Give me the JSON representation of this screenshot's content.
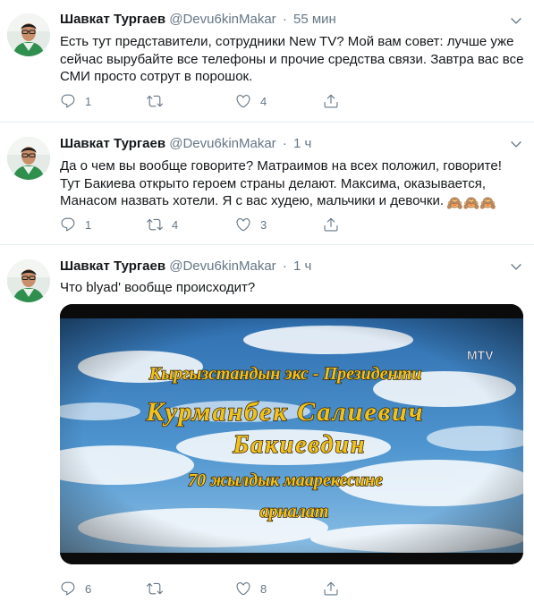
{
  "tweets": [
    {
      "name": "Шавкат Тургаев",
      "handle": "@Devu6kinMakar",
      "separator": "·",
      "time": "55 мин",
      "text": "Есть тут представители, сотрудники New TV? Мой вам совет: лучше уже сейчас вырубайте все телефоны и прочие средства связи. Завтра вас все СМИ просто сотрут в порошок.",
      "replies": "1",
      "retweets": "",
      "likes": "4"
    },
    {
      "name": "Шавкат Тургаев",
      "handle": "@Devu6kinMakar",
      "separator": "·",
      "time": "1 ч",
      "text": "Да о чем вы вообще говорите? Матраимов на всех положил, говорите! Тут Бакиева открыто героем страны делают. Максима, оказывается, Манасом назвать хотели. Я с вас худею, мальчики и девочки.",
      "emoji": "🙈🙈🙈",
      "replies": "1",
      "retweets": "4",
      "likes": "3"
    },
    {
      "name": "Шавкат Тургаев",
      "handle": "@Devu6kinMakar",
      "separator": "·",
      "time": "1 ч",
      "text": "Что blyad' вообще происходит?",
      "replies": "6",
      "retweets": "",
      "likes": "8",
      "media": {
        "logo": "MTV",
        "lines": [
          "Кыргызстандын экс - Президенти",
          "Курманбек Салиевич",
          "Бакиевдин",
          "70 жылдык маарекесине",
          "арналат"
        ]
      }
    }
  ],
  "icons": [
    "reply-icon",
    "retweet-icon",
    "like-icon",
    "share-icon",
    "caret-down-icon"
  ],
  "colors": {
    "text": "#14171a",
    "secondary": "#657786",
    "divider": "#e6ecf0",
    "caption_fill": "#f2c21a",
    "caption_stroke": "#2a1a05"
  }
}
